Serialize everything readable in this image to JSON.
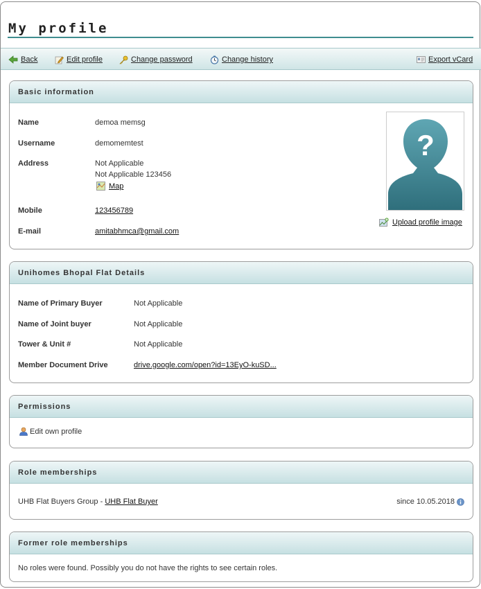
{
  "page": {
    "title": "My profile"
  },
  "toolbar": {
    "back": "Back",
    "edit_profile": "Edit profile",
    "change_password": "Change password",
    "change_history": "Change history",
    "export_vcard": "Export vCard"
  },
  "basic": {
    "heading": "Basic information",
    "name_label": "Name",
    "name_value": "demoa memsg",
    "username_label": "Username",
    "username_value": "demomemtest",
    "address_label": "Address",
    "address_line1": "Not Applicable",
    "address_line2": "Not Applicable 123456",
    "map_link": "Map",
    "mobile_label": "Mobile",
    "mobile_value": "123456789",
    "email_label": "E-mail",
    "email_value": "amitabhmca@gmail.com",
    "upload_link": "Upload profile image"
  },
  "flat": {
    "heading": "Unihomes Bhopal Flat Details",
    "rows": [
      {
        "label": "Name of Primary Buyer",
        "value": "Not Applicable"
      },
      {
        "label": "Name of Joint buyer",
        "value": "Not Applicable"
      },
      {
        "label": "Tower & Unit #",
        "value": "Not Applicable"
      },
      {
        "label": "Member Document Drive",
        "value": "drive.google.com/open?id=13EyO-kuSD..."
      }
    ]
  },
  "permissions": {
    "heading": "Permissions",
    "item": "Edit own profile"
  },
  "roles": {
    "heading": "Role memberships",
    "group_text": "UHB Flat Buyers Group - ",
    "role_link": "UHB Flat Buyer",
    "since": "since 10.05.2018"
  },
  "former": {
    "heading": "Former role memberships",
    "message": "No roles were found. Possibly you do not have the rights to see certain roles."
  },
  "colors": {
    "accent": "#3f8d8f",
    "header_gradient_end": "#c6e0e2",
    "avatar": "#3d8390"
  }
}
